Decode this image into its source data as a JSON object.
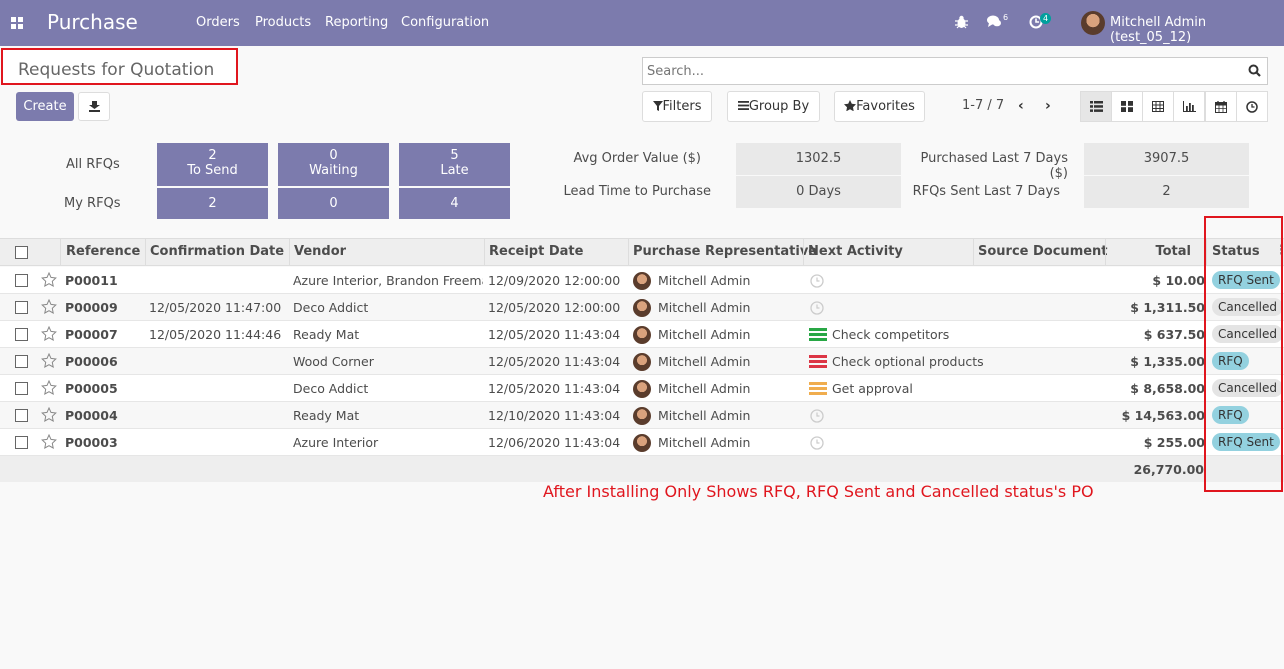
{
  "app": {
    "title": "Purchase",
    "user": "Mitchell Admin (test_05_12)",
    "messages_count": "6",
    "activities_count": "4"
  },
  "menu": [
    "Orders",
    "Products",
    "Reporting",
    "Configuration"
  ],
  "page": {
    "title": "Requests for Quotation",
    "create_label": "Create"
  },
  "search": {
    "placeholder": "Search..."
  },
  "toolbar": {
    "filters": "Filters",
    "group_by": "Group By",
    "favorites": "Favorites",
    "pager": "1-7 / 7"
  },
  "dashboard": {
    "all_rfqs_label": "All RFQs",
    "my_rfqs_label": "My RFQs",
    "cards": [
      {
        "count": "2",
        "label": "To Send",
        "mine": "2"
      },
      {
        "count": "0",
        "label": "Waiting",
        "mine": "0"
      },
      {
        "count": "5",
        "label": "Late",
        "mine": "4"
      }
    ],
    "stats": {
      "avg_order_label": "Avg Order Value ($)",
      "avg_order_value": "1302.5",
      "purchased_label": "Purchased Last 7 Days ($)",
      "purchased_value": "3907.5",
      "lead_time_label": "Lead Time to Purchase",
      "lead_time_value": "0  Days",
      "rfqs_sent_label": "RFQs Sent Last 7 Days",
      "rfqs_sent_value": "2"
    }
  },
  "table": {
    "columns": [
      "Reference",
      "Confirmation Date",
      "Vendor",
      "Receipt Date",
      "Purchase Representative",
      "Next Activity",
      "Source Document",
      "Total",
      "Status"
    ],
    "rows": [
      {
        "ref": "P00011",
        "conf": "",
        "vendor": "Azure Interior, Brandon Freeman",
        "receipt": "12/09/2020 12:00:00",
        "rep": "Mitchell Admin",
        "activity": "",
        "activity_type": "none",
        "total": "$ 10.00",
        "status": "RFQ Sent",
        "status_type": "rfq"
      },
      {
        "ref": "P00009",
        "conf": "12/05/2020 11:47:00",
        "vendor": "Deco Addict",
        "receipt": "12/05/2020 12:00:00",
        "rep": "Mitchell Admin",
        "activity": "",
        "activity_type": "none",
        "total": "$ 1,311.50",
        "status": "Cancelled",
        "status_type": "cancelled"
      },
      {
        "ref": "P00007",
        "conf": "12/05/2020 11:44:46",
        "vendor": "Ready Mat",
        "receipt": "12/05/2020 11:43:04",
        "rep": "Mitchell Admin",
        "activity": "Check competitors",
        "activity_type": "green",
        "total": "$ 637.50",
        "status": "Cancelled",
        "status_type": "cancelled"
      },
      {
        "ref": "P00006",
        "conf": "",
        "vendor": "Wood Corner",
        "receipt": "12/05/2020 11:43:04",
        "rep": "Mitchell Admin",
        "activity": "Check optional products",
        "activity_type": "red",
        "total": "$ 1,335.00",
        "status": "RFQ",
        "status_type": "rfq"
      },
      {
        "ref": "P00005",
        "conf": "",
        "vendor": "Deco Addict",
        "receipt": "12/05/2020 11:43:04",
        "rep": "Mitchell Admin",
        "activity": "Get approval",
        "activity_type": "yellow",
        "total": "$ 8,658.00",
        "status": "Cancelled",
        "status_type": "cancelled"
      },
      {
        "ref": "P00004",
        "conf": "",
        "vendor": "Ready Mat",
        "receipt": "12/10/2020 11:43:04",
        "rep": "Mitchell Admin",
        "activity": "",
        "activity_type": "none",
        "total": "$ 14,563.00",
        "status": "RFQ",
        "status_type": "rfq"
      },
      {
        "ref": "P00003",
        "conf": "",
        "vendor": "Azure Interior",
        "receipt": "12/06/2020 11:43:04",
        "rep": "Mitchell Admin",
        "activity": "",
        "activity_type": "none",
        "total": "$ 255.00",
        "status": "RFQ Sent",
        "status_type": "rfq"
      }
    ],
    "grand_total": "26,770.00"
  },
  "annotation": "After Installing Only Shows RFQ, RFQ Sent and Cancelled status's PO",
  "colors": {
    "brand": "#7c7bad",
    "rfq": "#93d1df",
    "cancelled": "#e4e4e4",
    "annotation": "#e0161e",
    "act_green": "#28a745",
    "act_red": "#dc3545",
    "act_yellow": "#f0ad4e"
  }
}
